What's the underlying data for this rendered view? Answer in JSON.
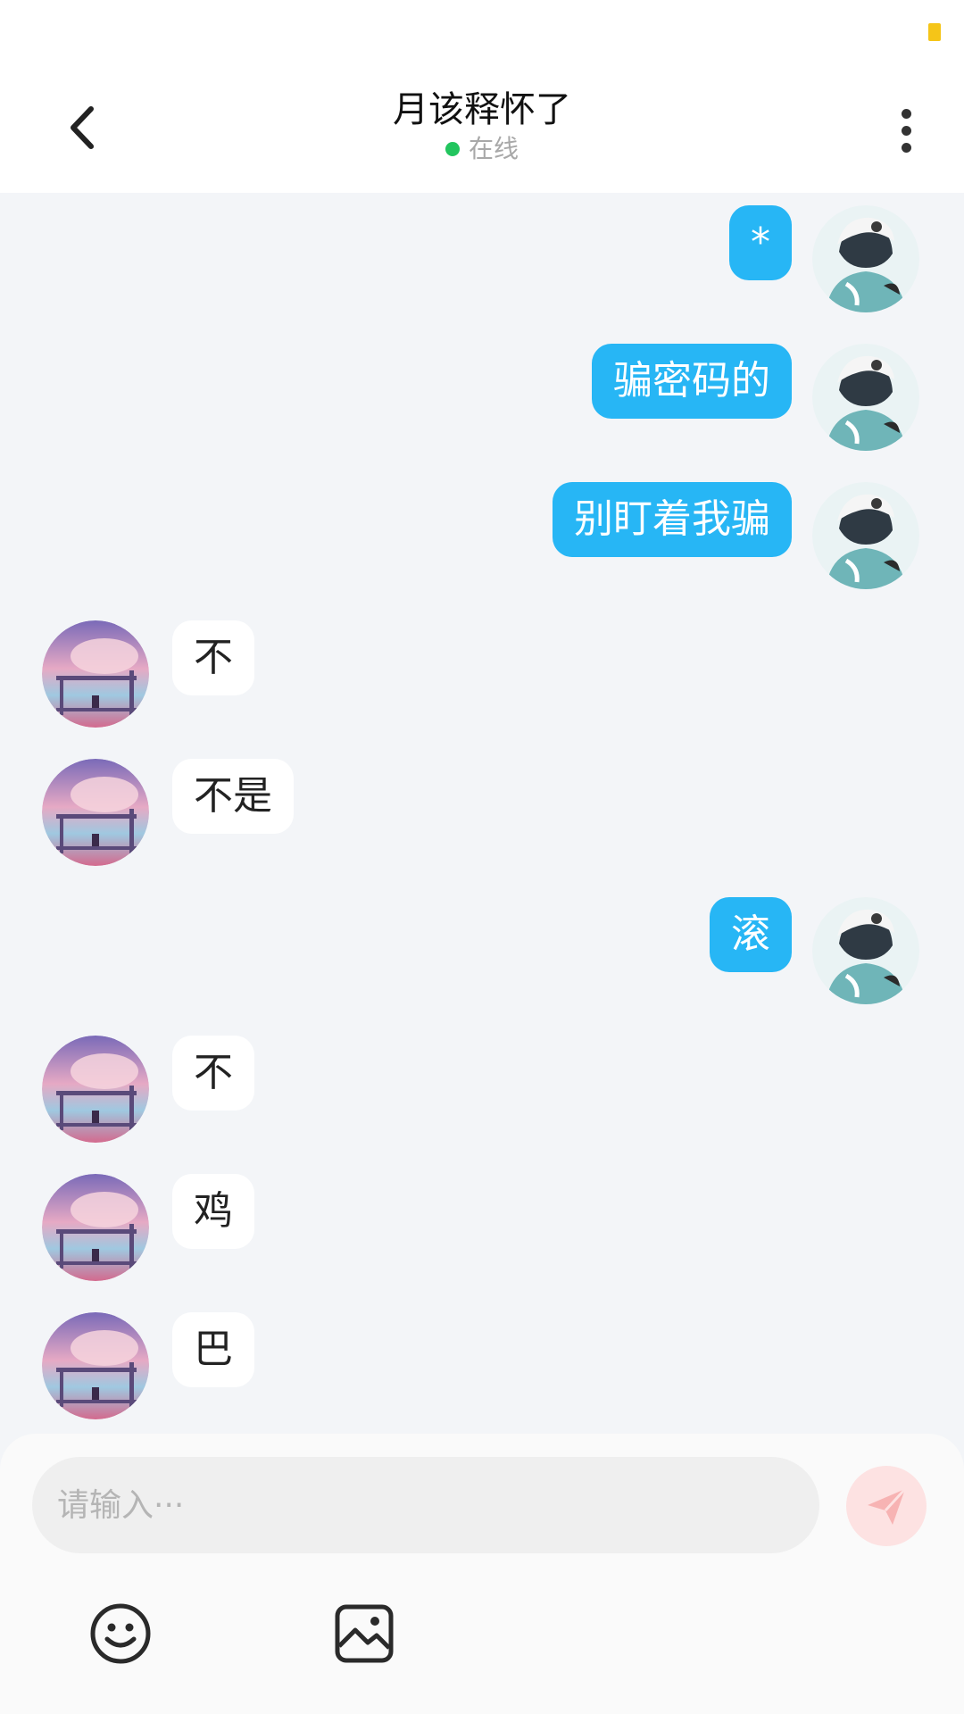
{
  "header": {
    "title": "月该释怀了",
    "status": "在线",
    "online_color": "#22c55e"
  },
  "messages": [
    {
      "side": "right",
      "text": "*"
    },
    {
      "side": "right",
      "text": "骗密码的"
    },
    {
      "side": "right",
      "text": "别盯着我骗"
    },
    {
      "side": "left",
      "text": "不"
    },
    {
      "side": "left",
      "text": "不是"
    },
    {
      "side": "right",
      "text": "滚"
    },
    {
      "side": "left",
      "text": "不"
    },
    {
      "side": "left",
      "text": "鸡"
    },
    {
      "side": "left",
      "text": "巴"
    }
  ],
  "composer": {
    "placeholder": "请输入···",
    "value": "",
    "send_icon": "send-icon",
    "tools": [
      "emoji-icon",
      "image-icon"
    ]
  },
  "colors": {
    "sent_bubble": "#27b6f5",
    "received_bubble": "#ffffff",
    "chat_background": "#f3f5f8",
    "send_button_bg": "#fde2e2",
    "send_icon": "#f7b3b3",
    "status_indicator": "#f5c518"
  }
}
